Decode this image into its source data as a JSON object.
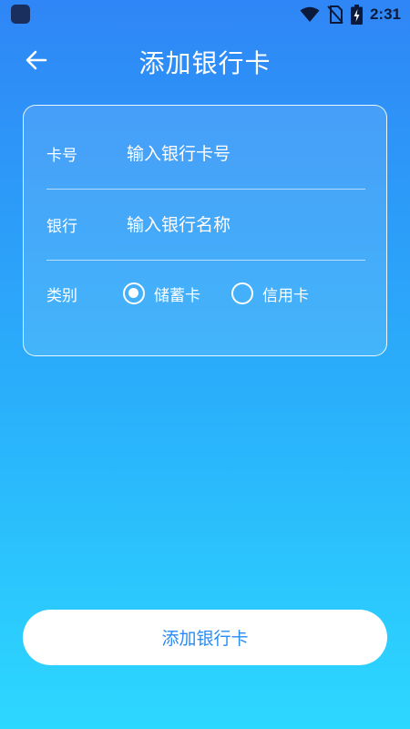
{
  "status_bar": {
    "time": "2:31",
    "icons": [
      "wifi-icon",
      "no-sim-icon",
      "battery-charging-icon"
    ]
  },
  "header": {
    "title": "添加银行卡",
    "back_icon": "arrow-left-icon"
  },
  "form": {
    "card_number": {
      "label": "卡号",
      "placeholder": "输入银行卡号",
      "value": ""
    },
    "bank": {
      "label": "银行",
      "placeholder": "输入银行名称",
      "value": ""
    },
    "type": {
      "label": "类别",
      "options": [
        {
          "label": "储蓄卡",
          "selected": true
        },
        {
          "label": "信用卡",
          "selected": false
        }
      ]
    }
  },
  "submit_label": "添加银行卡",
  "colors": {
    "gradient_top": "#2f86f6",
    "gradient_bottom": "#2cd8ff",
    "button_text": "#2a8bf2",
    "status_dark": "#0b1a3a"
  }
}
